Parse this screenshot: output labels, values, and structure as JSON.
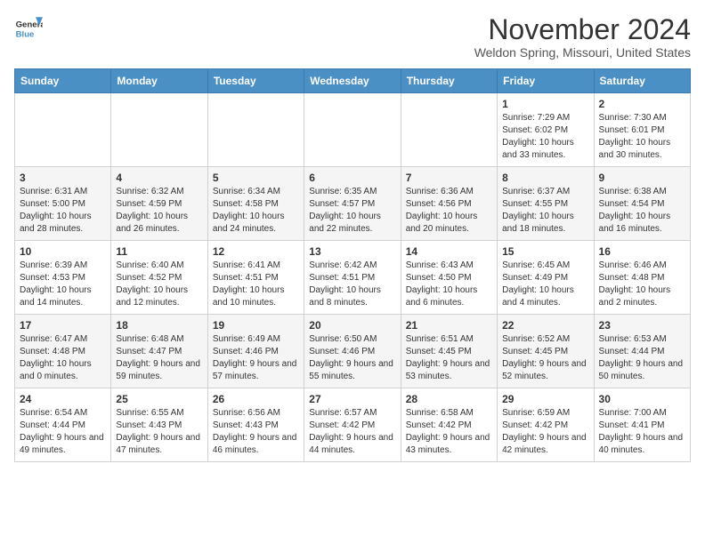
{
  "logo": {
    "line1": "General",
    "line2": "Blue"
  },
  "title": "November 2024",
  "location": "Weldon Spring, Missouri, United States",
  "days_of_week": [
    "Sunday",
    "Monday",
    "Tuesday",
    "Wednesday",
    "Thursday",
    "Friday",
    "Saturday"
  ],
  "weeks": [
    [
      {
        "day": "",
        "info": ""
      },
      {
        "day": "",
        "info": ""
      },
      {
        "day": "",
        "info": ""
      },
      {
        "day": "",
        "info": ""
      },
      {
        "day": "",
        "info": ""
      },
      {
        "day": "1",
        "info": "Sunrise: 7:29 AM\nSunset: 6:02 PM\nDaylight: 10 hours and 33 minutes."
      },
      {
        "day": "2",
        "info": "Sunrise: 7:30 AM\nSunset: 6:01 PM\nDaylight: 10 hours and 30 minutes."
      }
    ],
    [
      {
        "day": "3",
        "info": "Sunrise: 6:31 AM\nSunset: 5:00 PM\nDaylight: 10 hours and 28 minutes."
      },
      {
        "day": "4",
        "info": "Sunrise: 6:32 AM\nSunset: 4:59 PM\nDaylight: 10 hours and 26 minutes."
      },
      {
        "day": "5",
        "info": "Sunrise: 6:34 AM\nSunset: 4:58 PM\nDaylight: 10 hours and 24 minutes."
      },
      {
        "day": "6",
        "info": "Sunrise: 6:35 AM\nSunset: 4:57 PM\nDaylight: 10 hours and 22 minutes."
      },
      {
        "day": "7",
        "info": "Sunrise: 6:36 AM\nSunset: 4:56 PM\nDaylight: 10 hours and 20 minutes."
      },
      {
        "day": "8",
        "info": "Sunrise: 6:37 AM\nSunset: 4:55 PM\nDaylight: 10 hours and 18 minutes."
      },
      {
        "day": "9",
        "info": "Sunrise: 6:38 AM\nSunset: 4:54 PM\nDaylight: 10 hours and 16 minutes."
      }
    ],
    [
      {
        "day": "10",
        "info": "Sunrise: 6:39 AM\nSunset: 4:53 PM\nDaylight: 10 hours and 14 minutes."
      },
      {
        "day": "11",
        "info": "Sunrise: 6:40 AM\nSunset: 4:52 PM\nDaylight: 10 hours and 12 minutes."
      },
      {
        "day": "12",
        "info": "Sunrise: 6:41 AM\nSunset: 4:51 PM\nDaylight: 10 hours and 10 minutes."
      },
      {
        "day": "13",
        "info": "Sunrise: 6:42 AM\nSunset: 4:51 PM\nDaylight: 10 hours and 8 minutes."
      },
      {
        "day": "14",
        "info": "Sunrise: 6:43 AM\nSunset: 4:50 PM\nDaylight: 10 hours and 6 minutes."
      },
      {
        "day": "15",
        "info": "Sunrise: 6:45 AM\nSunset: 4:49 PM\nDaylight: 10 hours and 4 minutes."
      },
      {
        "day": "16",
        "info": "Sunrise: 6:46 AM\nSunset: 4:48 PM\nDaylight: 10 hours and 2 minutes."
      }
    ],
    [
      {
        "day": "17",
        "info": "Sunrise: 6:47 AM\nSunset: 4:48 PM\nDaylight: 10 hours and 0 minutes."
      },
      {
        "day": "18",
        "info": "Sunrise: 6:48 AM\nSunset: 4:47 PM\nDaylight: 9 hours and 59 minutes."
      },
      {
        "day": "19",
        "info": "Sunrise: 6:49 AM\nSunset: 4:46 PM\nDaylight: 9 hours and 57 minutes."
      },
      {
        "day": "20",
        "info": "Sunrise: 6:50 AM\nSunset: 4:46 PM\nDaylight: 9 hours and 55 minutes."
      },
      {
        "day": "21",
        "info": "Sunrise: 6:51 AM\nSunset: 4:45 PM\nDaylight: 9 hours and 53 minutes."
      },
      {
        "day": "22",
        "info": "Sunrise: 6:52 AM\nSunset: 4:45 PM\nDaylight: 9 hours and 52 minutes."
      },
      {
        "day": "23",
        "info": "Sunrise: 6:53 AM\nSunset: 4:44 PM\nDaylight: 9 hours and 50 minutes."
      }
    ],
    [
      {
        "day": "24",
        "info": "Sunrise: 6:54 AM\nSunset: 4:44 PM\nDaylight: 9 hours and 49 minutes."
      },
      {
        "day": "25",
        "info": "Sunrise: 6:55 AM\nSunset: 4:43 PM\nDaylight: 9 hours and 47 minutes."
      },
      {
        "day": "26",
        "info": "Sunrise: 6:56 AM\nSunset: 4:43 PM\nDaylight: 9 hours and 46 minutes."
      },
      {
        "day": "27",
        "info": "Sunrise: 6:57 AM\nSunset: 4:42 PM\nDaylight: 9 hours and 44 minutes."
      },
      {
        "day": "28",
        "info": "Sunrise: 6:58 AM\nSunset: 4:42 PM\nDaylight: 9 hours and 43 minutes."
      },
      {
        "day": "29",
        "info": "Sunrise: 6:59 AM\nSunset: 4:42 PM\nDaylight: 9 hours and 42 minutes."
      },
      {
        "day": "30",
        "info": "Sunrise: 7:00 AM\nSunset: 4:41 PM\nDaylight: 9 hours and 40 minutes."
      }
    ]
  ]
}
